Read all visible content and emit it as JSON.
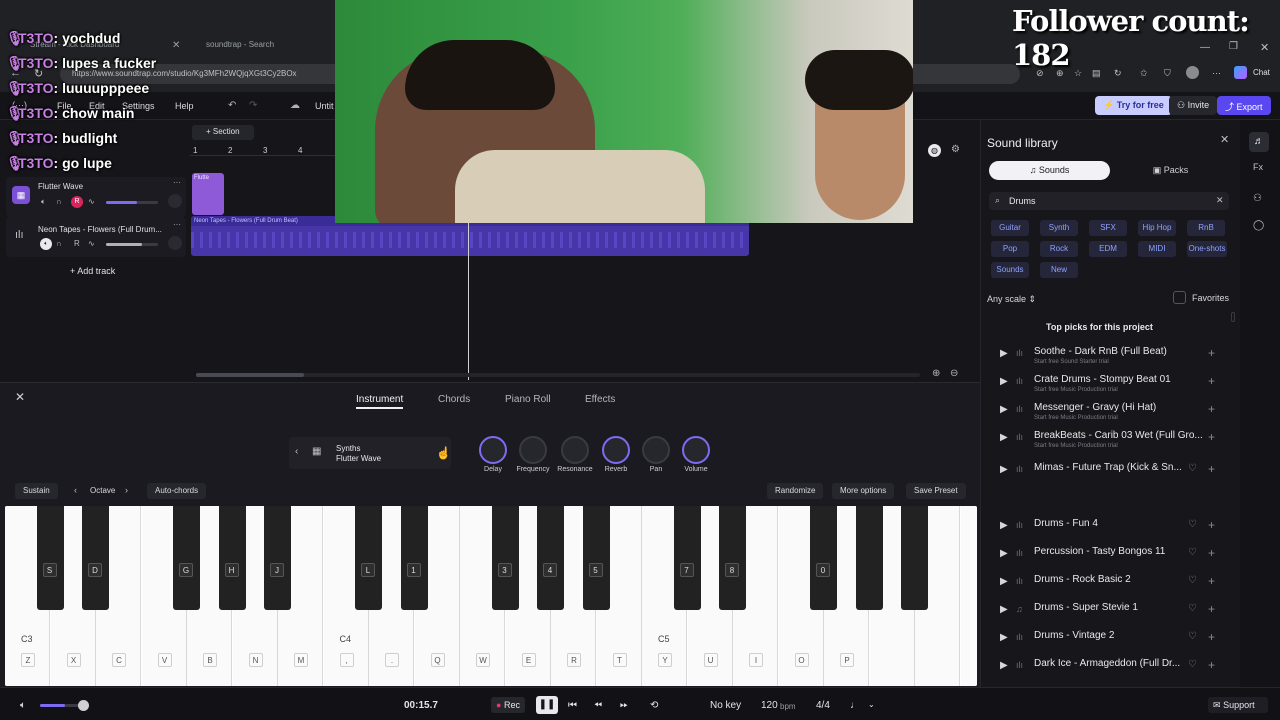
{
  "browser": {
    "tabs": [
      "Stream - Kick Dashboard",
      "soundtrap - Search"
    ],
    "url": "https://www.soundtrap.com/studio/Kg3MFh2WQjqXGt3Cy2BOx",
    "chat_label": "Chat"
  },
  "overlay": {
    "follower_count": "Follower count: 182",
    "chat": [
      {
        "user": "T3TO",
        "msg": ": yochdud"
      },
      {
        "user": "T3TO",
        "msg": ": lupes a fucker"
      },
      {
        "user": "T3TO",
        "msg": ": luuuupppeee"
      },
      {
        "user": "T3TO",
        "msg": ": chow main"
      },
      {
        "user": "T3TO",
        "msg": ": budlight"
      },
      {
        "user": "T3TO",
        "msg": ": go lupe"
      }
    ]
  },
  "app": {
    "menu": [
      "File",
      "Edit",
      "Settings",
      "Help"
    ],
    "project_title": "Untit",
    "try_free": "Try for free",
    "invite": "Invite",
    "export": "Export"
  },
  "arrange": {
    "section_label": "+ Section",
    "ruler": [
      "1",
      "2",
      "3",
      "4"
    ],
    "tracks": [
      {
        "name": "Flutter Wave",
        "clip": "Flutte",
        "volume": 0.6,
        "rec": "R"
      },
      {
        "name": "Neon Tapes - Flowers (Full Drum...",
        "clip": "Neon Tapes - Flowers (Full Drum Beat)",
        "volume": 0.7,
        "rec": "R"
      }
    ],
    "add_track": "+ Add track"
  },
  "library": {
    "title": "Sound library",
    "tabs": [
      "Sounds",
      "Packs"
    ],
    "search_value": "Drums",
    "chips": [
      "Guitar",
      "Synth",
      "SFX",
      "Hip Hop",
      "RnB",
      "Pop",
      "Rock",
      "EDM",
      "MIDI",
      "One-shots",
      "Sounds",
      "New"
    ],
    "scale": "Any scale",
    "favorites": "Favorites",
    "section_title": "Top picks for this project",
    "items": [
      {
        "title": "Soothe - Dark RnB (Full Beat)",
        "sub": "Start free Sound Starter trial",
        "icon": "wave"
      },
      {
        "title": "Crate Drums - Stompy Beat 01",
        "sub": "Start free Music Production trial",
        "icon": "wave"
      },
      {
        "title": "Messenger - Gravy (Hi Hat)",
        "sub": "Start free Music Production trial",
        "icon": "wave"
      },
      {
        "title": "BreakBeats - Carib 03 Wet (Full Gro...",
        "sub": "Start free Music Production trial",
        "icon": "wave"
      },
      {
        "title": "Mimas - Future Trap (Kick & Sn...",
        "sub": "",
        "icon": "wave"
      },
      {
        "title": "Drums - Fun 4",
        "sub": "",
        "icon": "wave"
      },
      {
        "title": "Percussion - Tasty Bongos 11",
        "sub": "",
        "icon": "wave"
      },
      {
        "title": "Drums - Rock Basic 2",
        "sub": "",
        "icon": "wave"
      },
      {
        "title": "Drums - Super Stevie 1",
        "sub": "",
        "icon": "note"
      },
      {
        "title": "Drums - Vintage 2",
        "sub": "",
        "icon": "wave"
      },
      {
        "title": "Dark Ice - Armageddon (Full Dr...",
        "sub": "",
        "icon": "wave"
      }
    ]
  },
  "instrument": {
    "tabs": [
      "Instrument",
      "Chords",
      "Piano Roll",
      "Effects"
    ],
    "preset_category": "Synths",
    "preset_name": "Flutter Wave",
    "knobs": [
      "Delay",
      "Frequency",
      "Resonance",
      "Reverb",
      "Pan",
      "Volume"
    ],
    "sustain": "Sustain",
    "octave": "Octave",
    "auto_chords": "Auto-chords",
    "randomize": "Randomize",
    "more_options": "More options",
    "save_preset": "Save Preset",
    "white_labels": [
      "Z",
      "X",
      "C",
      "V",
      "B",
      "N",
      "M",
      ",",
      ".",
      "Q",
      "W",
      "E",
      "R",
      "T",
      "Y",
      "U",
      "I",
      "O",
      "P"
    ],
    "black_labels": [
      "S",
      "D",
      "G",
      "H",
      "J",
      "L",
      "1",
      "3",
      "4",
      "5",
      "7",
      "8",
      "0"
    ],
    "octave_labels": [
      "C3",
      "C4",
      "C5"
    ]
  },
  "transport": {
    "time": "00:15.7",
    "rec": "Rec",
    "key": "No key",
    "bpm": "120",
    "bpm_unit": "bpm",
    "signature": "4/4",
    "support": "Support",
    "master_volume": 0.55
  }
}
